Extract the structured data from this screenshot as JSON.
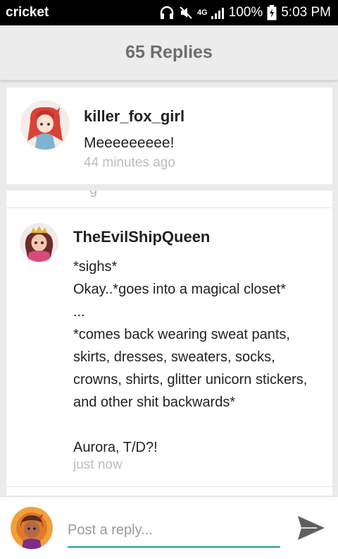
{
  "status_bar": {
    "carrier": "cricket",
    "network": "4G",
    "battery": "100%",
    "time": "5:03 PM"
  },
  "header": {
    "title": "65 Replies"
  },
  "reply": {
    "username": "killer_fox_girl",
    "message": "Meeeeeeeee!",
    "time": "44 minutes ago"
  },
  "thread": {
    "clipped_text": "g",
    "username": "TheEvilShipQueen",
    "lines": [
      "*sighs*",
      "Okay..*goes into a magical closet*",
      "...",
      "*comes back wearing sweat pants,",
      "skirts, dresses, sweaters, socks,",
      "crowns, shirts, glitter unicorn stickers,",
      "and other shit backwards*",
      "",
      "Aurora, T/D?!"
    ],
    "time": "just now"
  },
  "composer": {
    "placeholder": "Post a reply...",
    "send_icon": "send-icon"
  },
  "colors": {
    "accent": "#1e9e96",
    "status_bar": "#000000",
    "header_bg": "#ececec",
    "timestamp": "#bdbdbd"
  }
}
